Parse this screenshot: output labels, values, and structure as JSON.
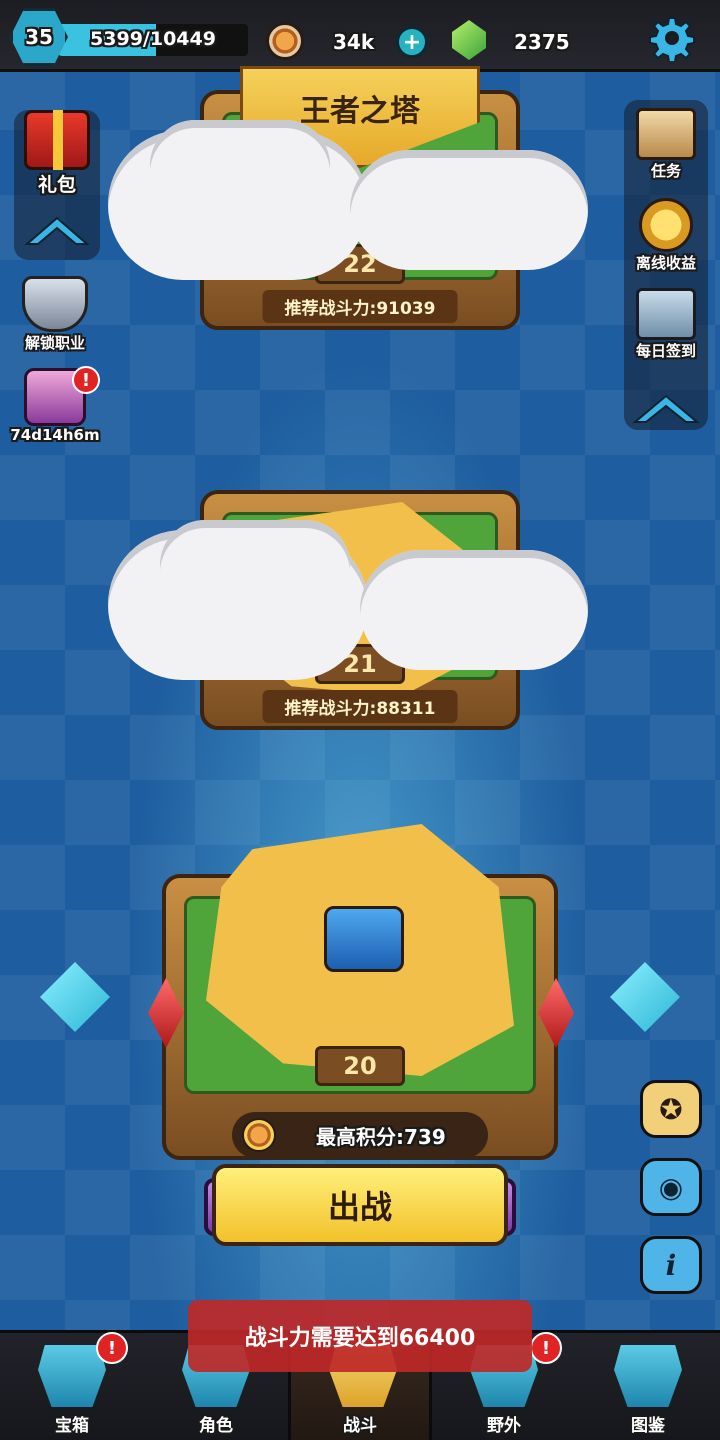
{
  "header": {
    "level": "35",
    "xp_text": "5399/10449",
    "xp_progress": 0.517,
    "coins": "34k",
    "gems": "2375",
    "icons": {
      "level": "level-hexagon-icon",
      "coin": "coin-icon",
      "add": "plus-icon",
      "gem": "green-gem-icon",
      "settings": "gear-icon"
    }
  },
  "title": "王者之塔",
  "left_sidebar": {
    "gift": {
      "label": "礼包",
      "icon": "gift-box-icon"
    },
    "unlock_class": {
      "label": "解锁职业",
      "icon": "armor-icon"
    },
    "timer_chest": {
      "label": "74d14h6m",
      "icon": "treasure-chest-icon",
      "alert": "!"
    }
  },
  "right_sidebar": {
    "tasks": {
      "label": "任务",
      "icon": "task-scroll-icon"
    },
    "offline_income": {
      "label": "离线收益",
      "icon": "gold-coin-icon"
    },
    "daily_checkin": {
      "label": "每日签到",
      "icon": "checkin-icon"
    }
  },
  "stages": [
    {
      "number": "22",
      "power": "推荐战斗力:91039"
    },
    {
      "number": "21",
      "power": "推荐战斗力:88311"
    },
    {
      "number": "20",
      "best_score": "最高积分:739"
    }
  ],
  "battle_button": "出战",
  "toast": "战斗力需要达到66400",
  "right_buttons": [
    {
      "name": "medal-button",
      "glyph": "✪",
      "color": "#f2d07a"
    },
    {
      "name": "eye-button",
      "glyph": "◉",
      "color": "#4fb4e8"
    },
    {
      "name": "info-button",
      "glyph": "i",
      "color": "#4fb4e8"
    }
  ],
  "bottom_nav": [
    {
      "label": "宝箱",
      "icon": "chest-nav-icon",
      "alert": "!",
      "active": false
    },
    {
      "label": "角色",
      "icon": "character-nav-icon",
      "active": false
    },
    {
      "label": "战斗",
      "icon": "battle-nav-icon",
      "active": true
    },
    {
      "label": "野外",
      "icon": "castle-nav-icon",
      "alert": "!",
      "active": false
    },
    {
      "label": "图鉴",
      "icon": "book-nav-icon",
      "active": false
    }
  ],
  "colors": {
    "accent_blue": "#2cb6d6",
    "gold": "#f2c12b",
    "alert_red": "#e02424",
    "toast_red": "#be2828"
  }
}
